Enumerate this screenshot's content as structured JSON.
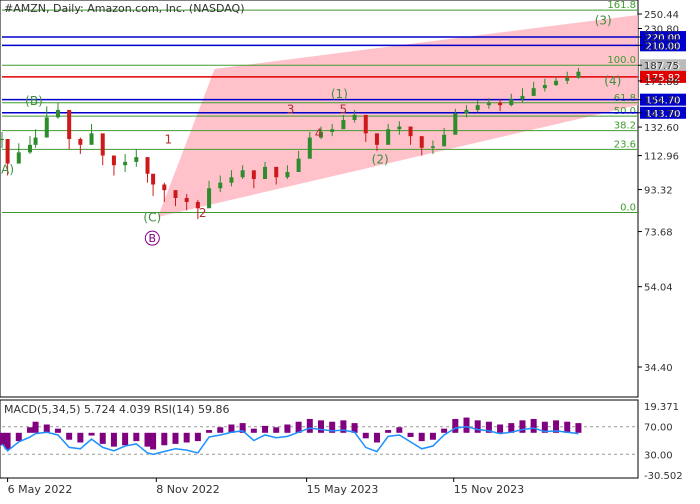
{
  "header": {
    "title": "#AMZN, Daily:  Amazon.com, Inc. (NASDAQ)"
  },
  "colors": {
    "background": "#ffffff",
    "channel_fill": "#ffb6c1",
    "fib_line": "#3f9b2f",
    "level_blue": "#0000cc",
    "level_red": "#e00000",
    "candle_up": "#2e8b2e",
    "candle_down": "#cc1a1a",
    "wave_label": "#3f8f3f",
    "wave_label_dark": "#b03030",
    "wave_circle": "#800080",
    "macd_hist": "#800080",
    "signal": "#1e90ff",
    "axis_text": "#333333"
  },
  "chart_data": [
    {
      "type": "candlestick",
      "title": "#AMZN, Daily:  Amazon.com, Inc. (NASDAQ)",
      "x_ticks": [
        "6 May 2022",
        "8 Nov 2022",
        "15 May 2023",
        "15 Nov 2023"
      ],
      "y_scale": "log",
      "y_ticks": [
        250.44,
        230.8,
        220.0,
        210.0,
        187.75,
        171.88,
        154.7,
        143.7,
        132.6,
        112.96,
        93.32,
        73.68,
        54.04,
        34.4
      ],
      "price_levels": [
        {
          "label": "220.00",
          "value": 220.0,
          "color": "#0000cc",
          "box": true
        },
        {
          "label": "210.00",
          "value": 210.0,
          "color": "#0000cc",
          "box": true
        },
        {
          "label": "187.75",
          "value": 187.75,
          "color": "#bbbbbb",
          "box": true
        },
        {
          "label": "175.82",
          "value": 175.82,
          "color": "#e00000",
          "box": true
        },
        {
          "label": "154.70",
          "value": 154.7,
          "color": "#0000cc",
          "box": true
        },
        {
          "label": "143.70",
          "value": 143.7,
          "color": "#0000cc",
          "box": true
        }
      ],
      "fib_levels": [
        {
          "label": "161.8",
          "value": 256.0
        },
        {
          "label": "100.0",
          "value": 187.75
        },
        {
          "label": "61.8",
          "value": 152.0
        },
        {
          "label": "50.0",
          "value": 141.0
        },
        {
          "label": "38.2",
          "value": 130.0
        },
        {
          "label": "23.6",
          "value": 117.0
        },
        {
          "label": "0.0",
          "value": 82.0
        }
      ],
      "wave_labels": [
        {
          "text": "A)",
          "date": "2022-05-06",
          "price": 102,
          "style": "green"
        },
        {
          "text": "(B)",
          "date": "2022-06-08",
          "price": 150,
          "style": "green"
        },
        {
          "text": "(C)",
          "date": "2022-11-03",
          "price": 78,
          "style": "green"
        },
        {
          "text": "B",
          "date": "2022-11-03",
          "price": 71,
          "style": "circle"
        },
        {
          "text": "1",
          "date": "2022-11-23",
          "price": 121,
          "style": "dark"
        },
        {
          "text": "2",
          "date": "2023-01-05",
          "price": 80,
          "style": "dark"
        },
        {
          "text": "3",
          "date": "2023-04-25",
          "price": 143,
          "style": "dark"
        },
        {
          "text": "4",
          "date": "2023-05-30",
          "price": 125,
          "style": "dark"
        },
        {
          "text": "5",
          "date": "2023-06-30",
          "price": 143,
          "style": "dark"
        },
        {
          "text": "(1)",
          "date": "2023-06-25",
          "price": 156,
          "style": "green"
        },
        {
          "text": "(2)",
          "date": "2023-08-15",
          "price": 108,
          "style": "green"
        },
        {
          "text": "(3)",
          "date": "2024-05-20",
          "price": 236,
          "style": "green"
        },
        {
          "text": "(4)",
          "date": "2024-06-01",
          "price": 168,
          "style": "green"
        }
      ],
      "price_series": {
        "dates": [
          "2022-04-29",
          "2022-05-06",
          "2022-05-20",
          "2022-06-03",
          "2022-06-10",
          "2022-06-24",
          "2022-07-08",
          "2022-07-22",
          "2022-08-05",
          "2022-08-19",
          "2022-09-02",
          "2022-09-16",
          "2022-09-30",
          "2022-10-14",
          "2022-10-28",
          "2022-11-04",
          "2022-11-18",
          "2022-12-02",
          "2022-12-16",
          "2022-12-30",
          "2023-01-13",
          "2023-01-27",
          "2023-02-10",
          "2023-02-24",
          "2023-03-10",
          "2023-03-24",
          "2023-04-07",
          "2023-04-21",
          "2023-05-05",
          "2023-05-19",
          "2023-06-02",
          "2023-06-16",
          "2023-06-30",
          "2023-07-14",
          "2023-07-28",
          "2023-08-11",
          "2023-08-25",
          "2023-09-08",
          "2023-09-22",
          "2023-10-06",
          "2023-10-20",
          "2023-11-03",
          "2023-11-17",
          "2023-12-01",
          "2023-12-15",
          "2023-12-29",
          "2024-01-12",
          "2024-01-26",
          "2024-02-09",
          "2024-02-23",
          "2024-03-08",
          "2024-03-22",
          "2024-04-05",
          "2024-04-19"
        ],
        "close": [
          124,
          108,
          115,
          120,
          125,
          140,
          146,
          124,
          120,
          128,
          113,
          107,
          109,
          112,
          102,
          96,
          93,
          89,
          87,
          84,
          94,
          97,
          100,
          104,
          99,
          106,
          100,
          103,
          111,
          125,
          129,
          131,
          138,
          142,
          128,
          120,
          131,
          133,
          126,
          118,
          119,
          127,
          143,
          146,
          150,
          152,
          150,
          155,
          158,
          165,
          168,
          172,
          175,
          181
        ],
        "high": [
          129,
          114,
          121,
          126,
          131,
          149,
          152,
          130,
          125,
          135,
          118,
          112,
          114,
          117,
          107,
          101,
          97,
          93,
          91,
          88,
          98,
          101,
          104,
          107,
          103,
          109,
          104,
          107,
          116,
          129,
          133,
          135,
          142,
          146,
          134,
          124,
          135,
          137,
          130,
          122,
          123,
          132,
          147,
          150,
          154,
          156,
          155,
          160,
          165,
          171,
          174,
          176,
          181,
          185
        ],
        "low": [
          118,
          101,
          109,
          114,
          118,
          133,
          139,
          117,
          114,
          121,
          107,
          101,
          103,
          106,
          97,
          90,
          87,
          85,
          83,
          79,
          88,
          92,
          95,
          99,
          94,
          100,
          96,
          99,
          106,
          117,
          124,
          126,
          132,
          136,
          122,
          116,
          124,
          127,
          120,
          113,
          114,
          121,
          136,
          140,
          144,
          147,
          145,
          149,
          152,
          159,
          162,
          167,
          169,
          174
        ]
      }
    },
    {
      "type": "histogram",
      "title": "MACD(5,34,5) 5.724 4.039 RSI(14) 59.86",
      "indicators": [
        {
          "name": "MACD(5,34,5)",
          "values": [
            5.724,
            4.039
          ]
        },
        {
          "name": "RSI(14)",
          "values": [
            59.86
          ]
        }
      ],
      "y_ticks": [
        19.371,
        70.0,
        30.0,
        -30.502
      ],
      "rsi_levels": [
        70,
        30
      ],
      "histogram": [
        -9,
        -12,
        -6,
        4,
        8,
        6,
        3,
        -5,
        -7,
        -2,
        -8,
        -10,
        -9,
        -6,
        -10,
        -12,
        -9,
        -8,
        -7,
        -6,
        2,
        4,
        6,
        7,
        3,
        5,
        4,
        6,
        8,
        10,
        9,
        8,
        9,
        7,
        -4,
        -7,
        2,
        4,
        -3,
        -6,
        -5,
        3,
        10,
        11,
        9,
        8,
        6,
        7,
        9,
        10,
        8,
        9,
        8,
        7
      ],
      "rsi": [
        45,
        35,
        48,
        55,
        60,
        62,
        58,
        40,
        38,
        52,
        40,
        35,
        42,
        45,
        32,
        30,
        34,
        38,
        36,
        32,
        55,
        58,
        62,
        64,
        50,
        58,
        54,
        56,
        62,
        68,
        66,
        64,
        65,
        62,
        40,
        34,
        56,
        58,
        48,
        38,
        42,
        58,
        68,
        70,
        66,
        64,
        60,
        62,
        66,
        68,
        63,
        64,
        62,
        60
      ]
    }
  ]
}
